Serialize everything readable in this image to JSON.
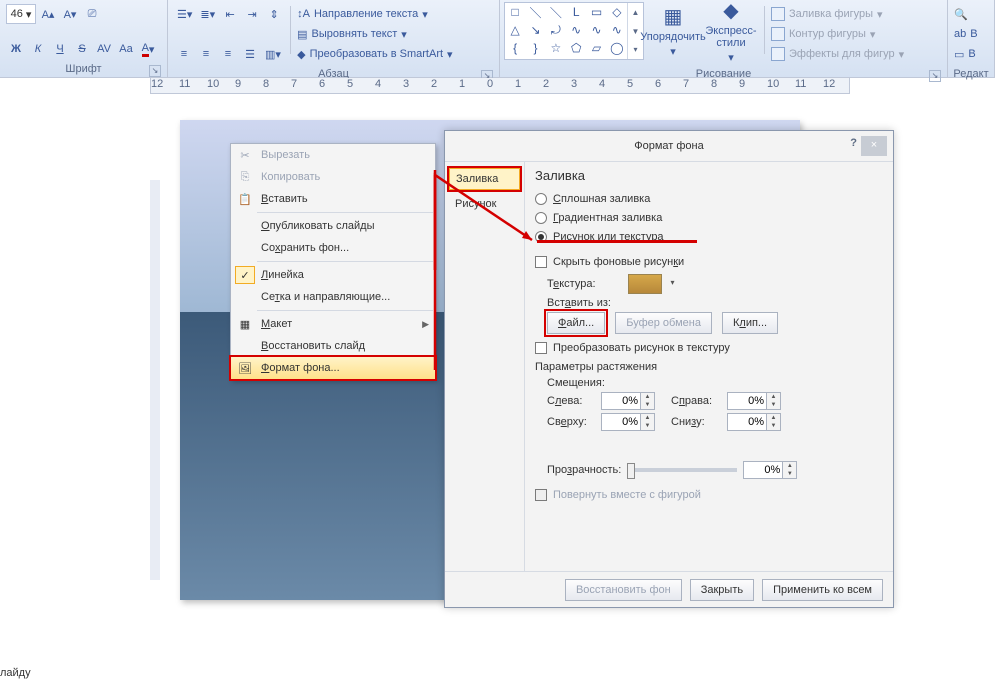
{
  "ribbon": {
    "font": {
      "label": "Шрифт",
      "size": "46",
      "bold": "Ж",
      "italic": "К",
      "ul": "Ч",
      "strike": "S",
      "shadow": "AV",
      "case": "Aa",
      "color": "A"
    },
    "para": {
      "label": "Абзац",
      "dir": "Направление текста",
      "align": "Выровнять текст",
      "smartart": "Преобразовать в SmartArt"
    },
    "draw": {
      "label": "Рисование",
      "arrange": "Упорядочить",
      "qstyles": "Экспресс-стили",
      "fill": "Заливка фигуры",
      "outline": "Контур фигуры",
      "effects": "Эффекты для фигур"
    },
    "edit": {
      "label": "Редакт",
      "replace": "В"
    }
  },
  "ruler": [
    "12",
    "11",
    "10",
    "9",
    "8",
    "7",
    "6",
    "5",
    "4",
    "3",
    "2",
    "1",
    "0",
    "1",
    "2",
    "3",
    "4",
    "5",
    "6",
    "7",
    "8",
    "9",
    "10",
    "11",
    "12"
  ],
  "context": {
    "cut": "Вырезать",
    "copy": "Копировать",
    "paste": "Вставить",
    "publish": "Опубликовать слайды",
    "savebg": "Сохранить фон...",
    "ruler": "Линейка",
    "grid": "Сетка и направляющие...",
    "layout": "Макет",
    "restore": "Восстановить слайд",
    "formatbg": "Формат фона..."
  },
  "dialog": {
    "title": "Формат фона",
    "help": "?",
    "close": "×",
    "nav_fill": "Заливка",
    "nav_pic": "Рисунок",
    "pane_title": "Заливка",
    "r_solid": "Сплошная заливка",
    "r_grad": "Градиентная заливка",
    "r_pic": "Рисунок или текстура",
    "c_hide": "Скрыть фоновые рисунки",
    "texture": "Текстура:",
    "insert_from": "Вставить из:",
    "b_file": "Файл...",
    "b_clip": "Буфер обмена",
    "b_clipart": "Клип...",
    "c_tile": "Преобразовать рисунок в текстуру",
    "stretch": "Параметры растяжения",
    "offsets": "Смещения:",
    "left": "Слева:",
    "right": "Справа:",
    "top": "Сверху:",
    "bottom": "Снизу:",
    "pct": "0%",
    "trans": "Прозрачность:",
    "c_rotate": "Повернуть вместе с фигурой",
    "b_reset": "Восстановить фон",
    "b_close": "Закрыть",
    "b_all": "Применить ко всем"
  },
  "footer": "лайду"
}
